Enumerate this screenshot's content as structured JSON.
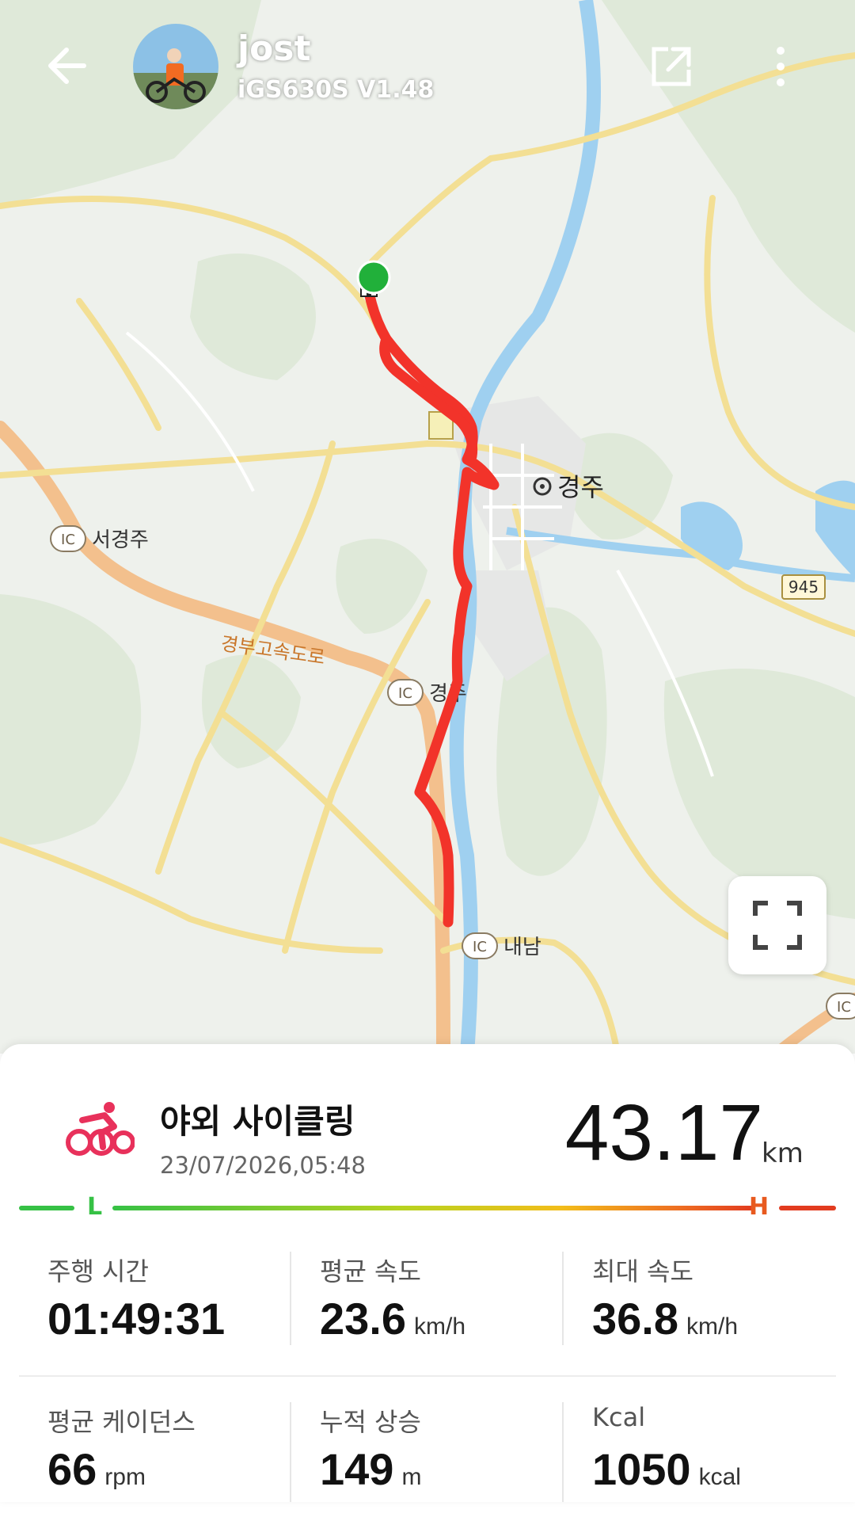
{
  "header": {
    "user_name": "jost",
    "device_name": "iGS630S  V1.48"
  },
  "map": {
    "places": {
      "city": "경주",
      "ic_seogyeongju": "서경주",
      "ic_gyeongju": "경주",
      "ic_naenam": "내남",
      "ic_badge": "IC",
      "highway": "경부고속도로",
      "route_number": "945",
      "ic_partial": "IC"
    },
    "route_color": "#f2332a",
    "start_color": "#21b03a"
  },
  "activity": {
    "title": "야외 사이클링",
    "date": "23/07/2026,05:48",
    "distance": "43.17",
    "distance_unit": "km",
    "icon_color": "#e8315b"
  },
  "scale": {
    "low": "L",
    "high": "H"
  },
  "stats": {
    "ride_time": {
      "label": "주행 시간",
      "value": "01:49:31",
      "unit": ""
    },
    "avg_speed": {
      "label": "평균 속도",
      "value": "23.6",
      "unit": "km/h"
    },
    "max_speed": {
      "label": "최대 속도",
      "value": "36.8",
      "unit": "km/h"
    },
    "avg_cadence": {
      "label": "평균 케이던스",
      "value": "66",
      "unit": "rpm"
    },
    "elevation": {
      "label": "누적 상승",
      "value": "149",
      "unit": "m"
    },
    "calories": {
      "label": "Kcal",
      "value": "1050",
      "unit": "kcal"
    }
  }
}
